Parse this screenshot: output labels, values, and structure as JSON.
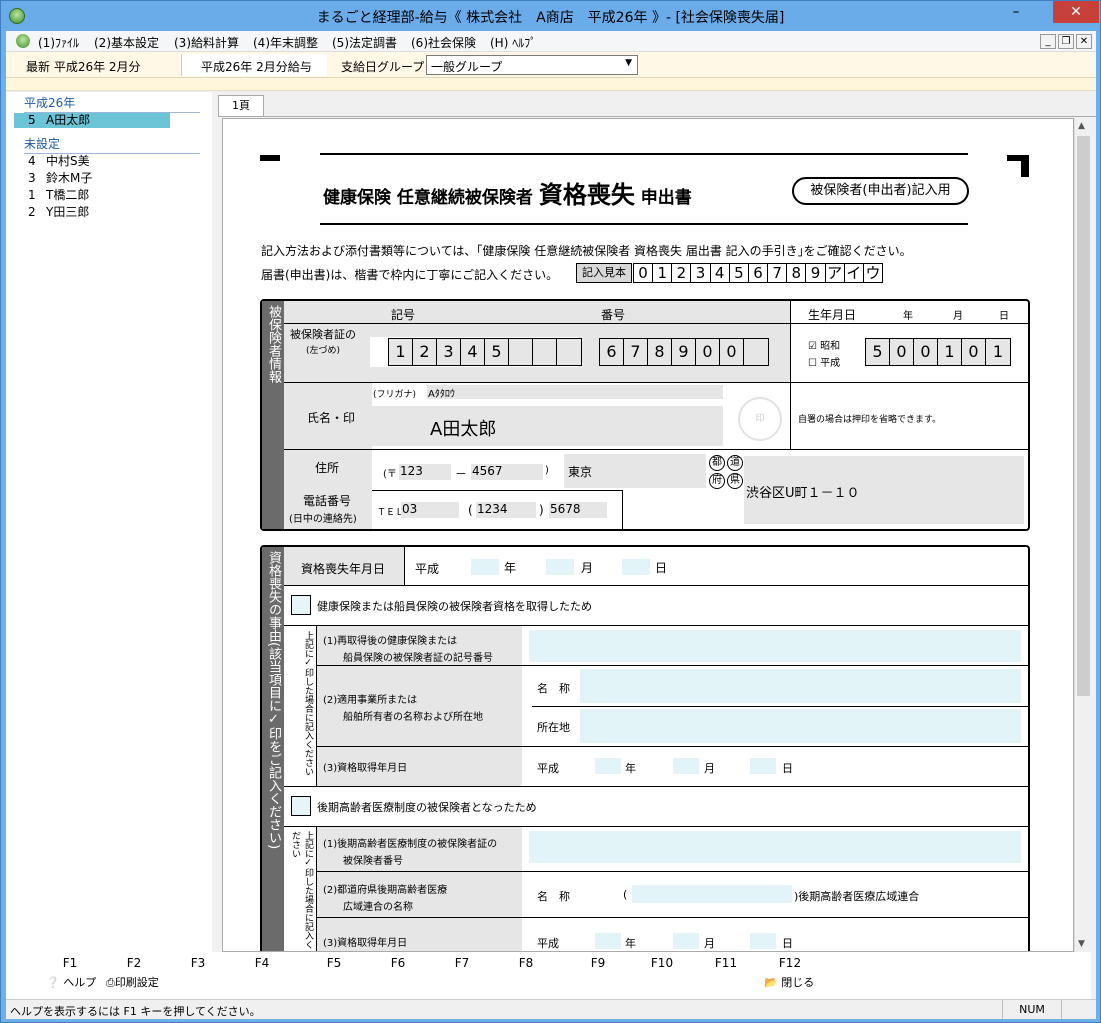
{
  "window": {
    "title": "まるごと経理部-給与《 株式会社　A商店　平成26年 》- [社会保険喪失届]"
  },
  "menu": [
    "(1)ﾌｧｲﾙ",
    "(2)基本設定",
    "(3)給料計算",
    "(4)年末調整",
    "(5)法定調書",
    "(6)社会保険",
    "(H) ﾍﾙﾌﾟ"
  ],
  "toolbar": {
    "latest": "最新 平成26年 2月分",
    "period": "平成26年 2月分給与",
    "group_label": "支給日グループ",
    "group_value": "一般グループ"
  },
  "sidebar": {
    "group1": "平成26年",
    "group1_items": [
      {
        "no": "5",
        "name": "A田太郎"
      }
    ],
    "group2": "未設定",
    "group2_items": [
      {
        "no": "4",
        "name": "中村S美"
      },
      {
        "no": "3",
        "name": "鈴木M子"
      },
      {
        "no": "1",
        "name": "T橋二郎"
      },
      {
        "no": "2",
        "name": "Y田三郎"
      }
    ]
  },
  "tab": "1頁",
  "form": {
    "title_a": "健康保険 任意継続被保険者",
    "title_b": "資格喪失",
    "title_c": "申出書",
    "badge": "被保険者(申出者)記入用",
    "note1": "記入方法および添付書類等については、｢健康保険 任意継続被保険者 資格喪失 届出書 記入の手引き｣をご確認ください。",
    "note2": "届書(申出書)は、楷書で枠内に丁寧にご記入ください。",
    "sample_label": "記入見本",
    "sample_chars": [
      "0",
      "1",
      "2",
      "3",
      "4",
      "5",
      "6",
      "7",
      "8",
      "9",
      "ア",
      "イ",
      "ウ"
    ],
    "sec1_head": "被保険者情報",
    "kigou": "記号",
    "bangou": "番号",
    "birth": "生年月日",
    "year": "年",
    "month": "月",
    "day": "日",
    "cert_label": "被保険者証の",
    "cert_sub": "(左づめ)",
    "kigou_digits": [
      "1",
      "2",
      "3",
      "4",
      "5",
      "",
      "",
      ""
    ],
    "bangou_digits": [
      "6",
      "7",
      "8",
      "9",
      "0",
      "0",
      ""
    ],
    "era_showa": "昭和",
    "era_heisei": "平成",
    "birth_digits": [
      "5",
      "0",
      "0",
      "1",
      "0",
      "1"
    ],
    "name_label": "氏名・印",
    "furigana_label": "(フリガナ)",
    "furigana": "Aﾀﾀﾛｳ",
    "name": "A田太郎",
    "seal": "印",
    "seal_note": "自署の場合は押印を省略できます。",
    "address_label": "住所",
    "phone_label": "電話番号",
    "phone_sub": "(日中の連絡先)",
    "zip_mark": "(〒",
    "zip1": "123",
    "zip_dash": "－",
    "zip2": "4567",
    "zip_close": ")",
    "pref": "東京",
    "pref_to": "都",
    "pref_dou": "道",
    "pref_fu": "府",
    "pref_ken": "県",
    "addr": "渋谷区U町１－１０",
    "tel_label": "ＴＥＬ",
    "tel1": "03",
    "tel2": "1234",
    "tel3": "5678",
    "tel_paren_open": "(",
    "tel_paren_close": ")",
    "sec2_head": "資格喪失の事由(該当項目に✓印をご記入ください)",
    "loss_date_label": "資格喪失年月日",
    "era": "平成",
    "reason1": "健康保険または船員保険の被保険者資格を取得したため",
    "sub_note": "上記に✓印した場合に記入ください",
    "r1_item1a": "(1)再取得後の健康保険または",
    "r1_item1b": "船員保険の被保険者証の記号番号",
    "r1_item2a": "(2)適用事業所または",
    "r1_item2b": "船舶所有者の名称および所在地",
    "r1_name": "名　称",
    "r1_loc": "所在地",
    "r1_item3": "(3)資格取得年月日",
    "reason2": "後期高齢者医療制度の被保険者となったため",
    "r2_item1a": "(1)後期高齢者医療制度の被保険者証の",
    "r2_item1b": "被保険者番号",
    "r2_item2a": "(2)都道府県後期高齢者医療",
    "r2_item2b": "広域連合の名称",
    "r2_name": "名　称",
    "r2_suffix": ")後期高齢者医療広域連合",
    "r2_item3": "(3)資格取得年月日"
  },
  "fkeys": [
    "F1",
    "F2",
    "F3",
    "F4",
    "F5",
    "F6",
    "F7",
    "F8",
    "F9",
    "F10",
    "F11",
    "F12"
  ],
  "factions": {
    "help": "ヘルプ",
    "print": "印刷設定",
    "close": "閉じる"
  },
  "status": {
    "message": "ヘルプを表示するには F1 キーを押してください。",
    "num": "NUM"
  }
}
